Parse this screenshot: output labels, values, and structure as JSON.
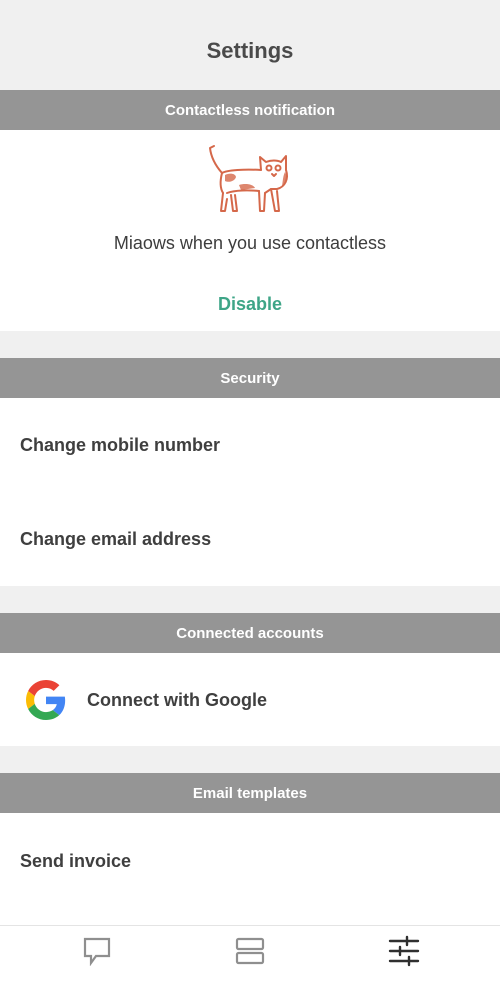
{
  "header": {
    "title": "Settings"
  },
  "contactless": {
    "section_title": "Contactless notification",
    "illustration": "cat-illustration",
    "description": "Miaows when you use contactless",
    "disable_label": "Disable"
  },
  "security": {
    "section_title": "Security",
    "items": [
      {
        "label": "Change mobile number"
      },
      {
        "label": "Change email address"
      }
    ]
  },
  "connected_accounts": {
    "section_title": "Connected accounts",
    "google_label": "Connect with Google",
    "icon": "google-logo"
  },
  "email_templates": {
    "section_title": "Email templates",
    "items": [
      {
        "label": "Send invoice"
      }
    ]
  },
  "tabbar": {
    "tabs": [
      {
        "icon": "chat-icon",
        "active": false
      },
      {
        "icon": "layout-icon",
        "active": false
      },
      {
        "icon": "sliders-icon",
        "active": true
      }
    ]
  },
  "colors": {
    "accent": "#3ea587",
    "section_header": "#959595",
    "cat": "#d5684a",
    "background": "#f0f0f0"
  }
}
